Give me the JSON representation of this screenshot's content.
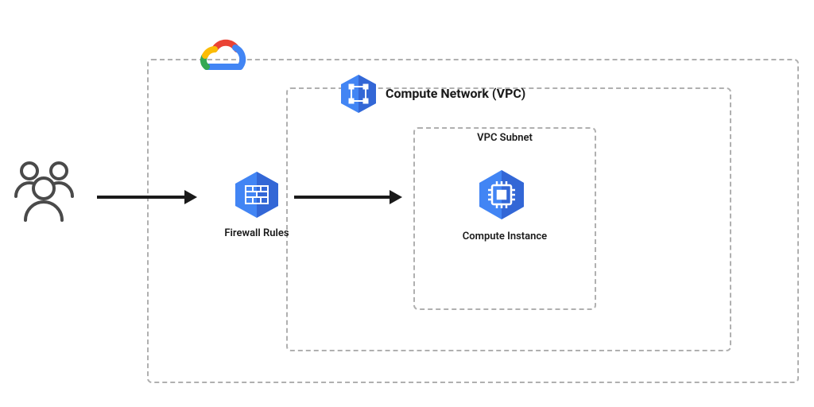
{
  "diagram": {
    "outer_box_label": "",
    "vpc_label": "Compute Network (VPC)",
    "subnet_label": "VPC Subnet",
    "firewall_label": "Firewall Rules",
    "compute_label": "Compute Instance"
  },
  "colors": {
    "gcp_blue": "#4285F4",
    "gcp_blue_dark": "#3367D6",
    "outline_gray": "#4a4a4a",
    "dash_gray": "#b0b0b0",
    "google_red": "#EA4335",
    "google_yellow": "#FBBC05",
    "google_green": "#34A853",
    "google_blue": "#4285F4"
  }
}
